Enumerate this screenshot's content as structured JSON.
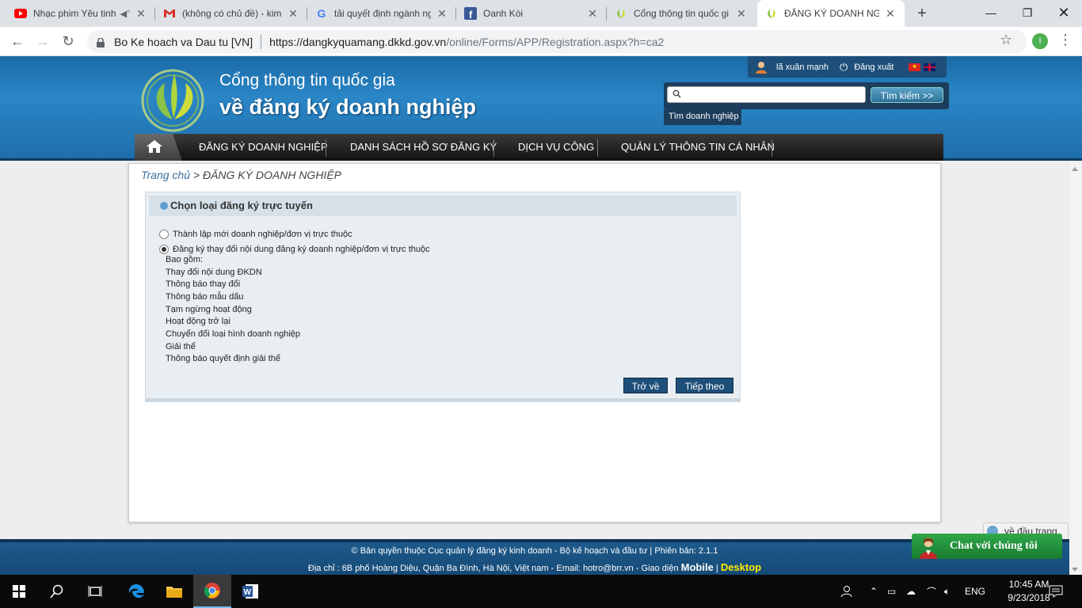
{
  "browser": {
    "tabs": [
      {
        "title": "Nhạc phim Yêu tinh",
        "icon": "youtube-icon",
        "audio": true
      },
      {
        "title": "(không có chủ đề) - kim",
        "icon": "gmail-icon"
      },
      {
        "title": "tải quyết định ngành ng",
        "icon": "google-icon"
      },
      {
        "title": "Oanh Kòi",
        "icon": "facebook-icon"
      },
      {
        "title": "Cổng thông tin quốc gi",
        "icon": "site-logo-icon"
      },
      {
        "title": "ĐĂNG KÝ DOANH NGH",
        "icon": "site-logo-icon",
        "active": true
      }
    ],
    "site_label": "Bo Ke hoach va Dau tu [VN]",
    "url_host": "https://dangkyquamang.dkkd.gov.vn",
    "url_path": "/online/Forms/APP/Registration.aspx?h=ca2",
    "profile_initial": "I"
  },
  "header": {
    "brand_line1": "Cổng thông tin quốc gia",
    "brand_line2": "về đăng ký doanh nghiệp",
    "user_name": "lã xuân mạnh",
    "logout": "Đăng xuất",
    "search_button": "Tìm kiếm >>",
    "search_hint": "Tìm doanh nghiệp",
    "search_placeholder": ""
  },
  "nav": {
    "items": [
      "ĐĂNG KÝ DOANH NGHIỆP",
      "DANH SÁCH HỒ SƠ ĐĂNG KÝ",
      "DỊCH VỤ CÔNG",
      "QUẢN LÝ THÔNG TIN CÁ NHÂN"
    ]
  },
  "breadcrumb": {
    "home": "Trang chủ",
    "separator": " > ",
    "current": "ĐĂNG KÝ DOANH NGHIỆP"
  },
  "panel": {
    "title": "Chọn loại đăng ký trực tuyến",
    "option1": "Thành lập mới doanh nghiệp/đơn vị trực thuộc",
    "option2": "Đăng ký thay đổi nội dung đăng ký doanh nghiệp/đơn vị trực thuộc",
    "selected_option": 2,
    "includes_label": "Bao gồm:",
    "includes": [
      "Thay đổi nội dung ĐKDN",
      "Thông báo thay đổi",
      "Thông báo mẫu dấu",
      "Tạm ngừng hoạt động",
      "Hoạt động trở lại",
      "Chuyển đổi loại hình doanh nghiệp",
      "Giải thể",
      "Thông báo quyết định giải thể"
    ],
    "back_button": "Trở về",
    "next_button": "Tiếp theo"
  },
  "to_top": "về đầu trang",
  "footer": {
    "line1": "© Bản quyền thuộc Cục quản lý đăng ký kinh doanh - Bộ kế hoạch và đầu tư | Phiên bản: 2.1.1",
    "line2_prefix": "Địa chỉ : 6B phố Hoàng Diệu, Quận Ba Đình, Hà Nội, Việt nam - Email: ",
    "email": "hotro@brr.vn",
    "line2_mid": " - Giao diện ",
    "mobile": "Mobile",
    "pipe": " | ",
    "desktop": "Desktop"
  },
  "chat": "Chat với chúng tôi",
  "taskbar": {
    "lang": "ENG",
    "time": "10:45 AM",
    "date": "9/23/2018"
  },
  "colors": {
    "header_blue": "#2a86c6",
    "nav_dark": "#111111",
    "button_navy": "#1e4f79",
    "footer_blue": "#1d5a8b",
    "chat_green": "#2fa84a",
    "desktop_yellow": "#ffea00"
  }
}
